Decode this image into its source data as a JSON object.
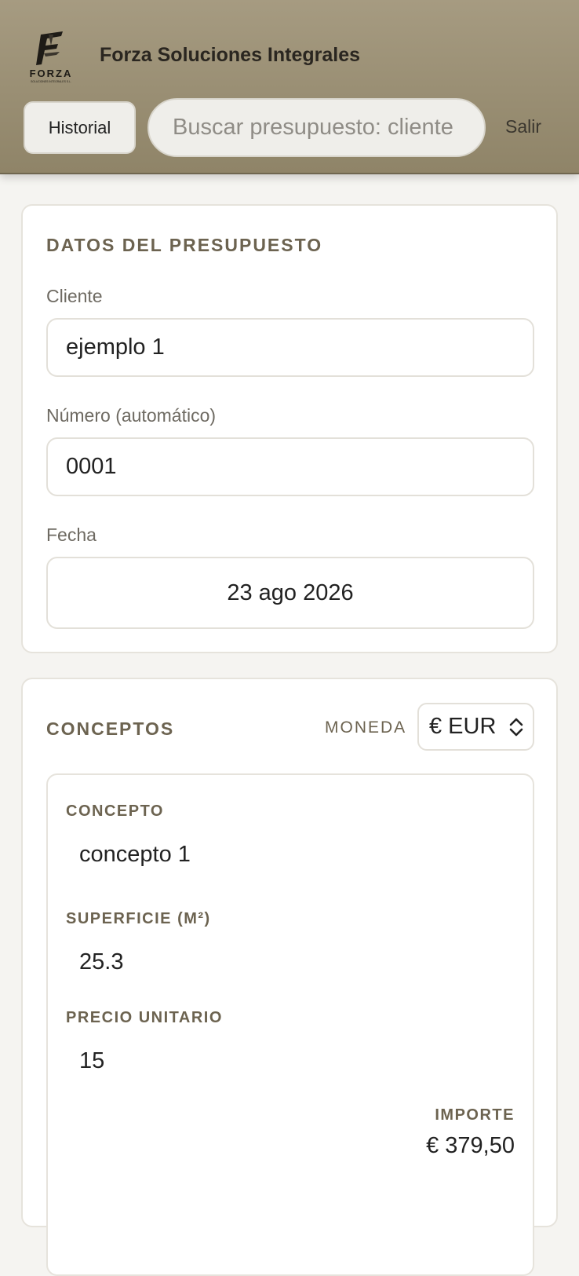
{
  "header": {
    "logo_text": "FORZA",
    "logo_subtext": "SOLUCIONES INTEGRALES S.L.",
    "title": "Forza Soluciones Integrales",
    "history_label": "Historial",
    "search_placeholder": "Buscar presupuesto: cliente",
    "logout_label": "Salir"
  },
  "datos": {
    "section_title": "DATOS DEL PRESUPUESTO",
    "cliente_label": "Cliente",
    "cliente_value": "ejemplo 1",
    "numero_label": "Número (automático)",
    "numero_value": "0001",
    "fecha_label": "Fecha",
    "fecha_value": "23 ago 2026"
  },
  "conceptos": {
    "section_title": "CONCEPTOS",
    "moneda_label": "MONEDA",
    "currency_value": "€ EUR",
    "items": [
      {
        "concepto_label": "CONCEPTO",
        "concepto_value": "concepto 1",
        "superficie_label": "SUPERFICIE (M²)",
        "superficie_value": "25.3",
        "precio_label": "PRECIO UNITARIO",
        "precio_value": "15",
        "importe_label": "IMPORTE",
        "importe_value": "€ 379,50"
      }
    ]
  },
  "colors": {
    "header_bg": "#a69b81",
    "accent_text": "#6c6350",
    "page_bg": "#f5f4f1"
  }
}
